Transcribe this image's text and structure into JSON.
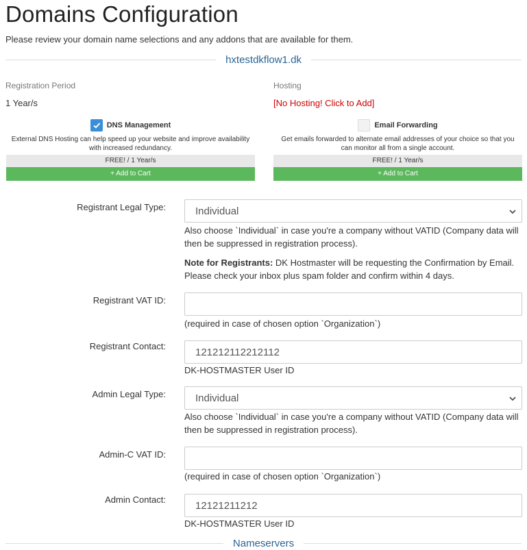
{
  "page": {
    "title": "Domains Configuration",
    "subtitle": "Please review your domain name selections and any addons that are available for them."
  },
  "domain": {
    "name": "hxtestdkflow1.dk"
  },
  "registration": {
    "label": "Registration Period",
    "value": "1 Year/s"
  },
  "hosting": {
    "label": "Hosting",
    "value": "[No Hosting! Click to Add]"
  },
  "addons": [
    {
      "name": "DNS Management",
      "checked": true,
      "description": "External DNS Hosting can help speed up your website and improve availability with increased redundancy.",
      "price": "FREE! / 1 Year/s",
      "button": "+ Add to Cart"
    },
    {
      "name": "Email Forwarding",
      "checked": false,
      "description": "Get emails forwarded to alternate email addresses of your choice so that you can monitor all from a single account.",
      "price": "FREE! / 1 Year/s",
      "button": "+ Add to Cart"
    }
  ],
  "fields": {
    "registrant_legal_type": {
      "label": "Registrant Legal Type:",
      "value": "Individual",
      "help": "Also choose `Individual` in case you're a company without VATID (Company data will then be suppressed in registration process).",
      "note_bold": "Note for Registrants:",
      "note_text": " DK Hostmaster will be requesting the Confirmation by Email. Please check your inbox plus spam folder and confirm within 4 days."
    },
    "registrant_vat_id": {
      "label": "Registrant VAT ID:",
      "value": "",
      "help": "(required in case of chosen option `Organization`)"
    },
    "registrant_contact": {
      "label": "Registrant Contact:",
      "value": "121212112212112",
      "help": "DK-HOSTMASTER User ID"
    },
    "admin_legal_type": {
      "label": "Admin Legal Type:",
      "value": "Individual",
      "help": "Also choose `Individual` in case you're a company without VATID (Company data will then be suppressed in registration process)."
    },
    "admin_vat_id": {
      "label": "Admin-C VAT ID:",
      "value": "",
      "help": "(required in case of chosen option `Organization`)"
    },
    "admin_contact": {
      "label": "Admin Contact:",
      "value": "12121211212",
      "help": "DK-HOSTMASTER User ID"
    }
  },
  "nameservers": {
    "heading": "Nameservers"
  },
  "colors": {
    "link": "#2a6496",
    "green": "#5cb85c",
    "checkbox": "#3a8fd8",
    "red": "#cc0000"
  }
}
